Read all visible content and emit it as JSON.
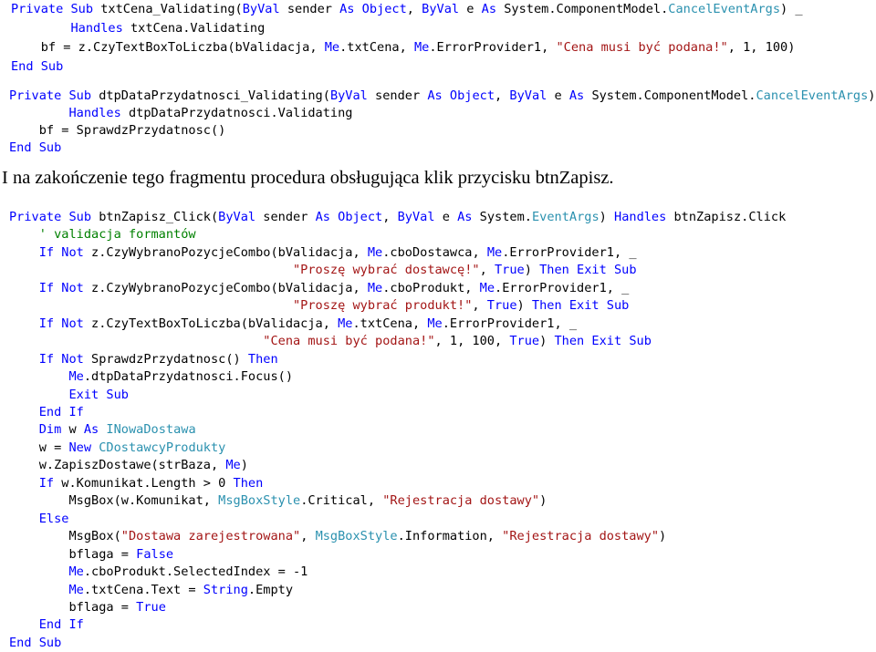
{
  "block1": [
    [
      [
        "kw",
        "Private Sub "
      ],
      [
        "tx",
        "txtCena_Validating("
      ],
      [
        "kw",
        "ByVal "
      ],
      [
        "tx",
        "sender "
      ],
      [
        "kw",
        "As Object"
      ],
      [
        "tx",
        ", "
      ],
      [
        "kw",
        "ByVal "
      ],
      [
        "tx",
        "e "
      ],
      [
        "kw",
        "As "
      ],
      [
        "tx",
        "System.ComponentModel."
      ],
      [
        "ty",
        "CancelEventArgs"
      ],
      [
        "tx",
        ") _"
      ]
    ],
    [
      [
        "kw",
        "        Handles "
      ],
      [
        "tx",
        "txtCena.Validating"
      ]
    ],
    [
      [
        "tx",
        "    bf = z.CzyTextBoxToLiczba(bValidacja, "
      ],
      [
        "kw",
        "Me"
      ],
      [
        "tx",
        ".txtCena, "
      ],
      [
        "kw",
        "Me"
      ],
      [
        "tx",
        ".ErrorProvider1, "
      ],
      [
        "st",
        "\"Cena musi być podana!\""
      ],
      [
        "tx",
        ", 1, 100)"
      ]
    ],
    [
      [
        "kw",
        "End Sub"
      ]
    ]
  ],
  "block2": [
    [
      [
        "kw",
        "Private Sub "
      ],
      [
        "tx",
        "dtpDataPrzydatnosci_Validating("
      ],
      [
        "kw",
        "ByVal "
      ],
      [
        "tx",
        "sender "
      ],
      [
        "kw",
        "As Object"
      ],
      [
        "tx",
        ", "
      ],
      [
        "kw",
        "ByVal "
      ],
      [
        "tx",
        "e "
      ],
      [
        "kw",
        "As "
      ],
      [
        "tx",
        "System.ComponentModel."
      ],
      [
        "ty",
        "CancelEventArgs"
      ],
      [
        "tx",
        ") _"
      ]
    ],
    [
      [
        "kw",
        "        Handles "
      ],
      [
        "tx",
        "dtpDataPrzydatnosci.Validating"
      ]
    ],
    [
      [
        "tx",
        "    bf = SprawdzPrzydatnosc()"
      ]
    ],
    [
      [
        "kw",
        "End Sub"
      ]
    ]
  ],
  "prose": "I na zakończenie tego fragmentu procedura obsługująca klik przycisku btnZapisz.",
  "block3": [
    [
      [
        "kw",
        "Private Sub "
      ],
      [
        "tx",
        "btnZapisz_Click("
      ],
      [
        "kw",
        "ByVal "
      ],
      [
        "tx",
        "sender "
      ],
      [
        "kw",
        "As Object"
      ],
      [
        "tx",
        ", "
      ],
      [
        "kw",
        "ByVal "
      ],
      [
        "tx",
        "e "
      ],
      [
        "kw",
        "As "
      ],
      [
        "tx",
        "System."
      ],
      [
        "ty",
        "EventArgs"
      ],
      [
        "tx",
        ") "
      ],
      [
        "kw",
        "Handles "
      ],
      [
        "tx",
        "btnZapisz.Click"
      ]
    ],
    [
      [
        "cm",
        "    ' validacja formantów"
      ]
    ],
    [
      [
        "kw",
        "    If Not "
      ],
      [
        "tx",
        "z.CzyWybranoPozycjeCombo(bValidacja, "
      ],
      [
        "kw",
        "Me"
      ],
      [
        "tx",
        ".cboDostawca, "
      ],
      [
        "kw",
        "Me"
      ],
      [
        "tx",
        ".ErrorProvider1, _"
      ]
    ],
    [
      [
        "tx",
        "                                      "
      ],
      [
        "st",
        "\"Proszę wybrać dostawcę!\""
      ],
      [
        "tx",
        ", "
      ],
      [
        "kw",
        "True"
      ],
      [
        "tx",
        ") "
      ],
      [
        "kw",
        "Then Exit Sub"
      ]
    ],
    [
      [
        "kw",
        "    If Not "
      ],
      [
        "tx",
        "z.CzyWybranoPozycjeCombo(bValidacja, "
      ],
      [
        "kw",
        "Me"
      ],
      [
        "tx",
        ".cboProdukt, "
      ],
      [
        "kw",
        "Me"
      ],
      [
        "tx",
        ".ErrorProvider1, _"
      ]
    ],
    [
      [
        "tx",
        "                                      "
      ],
      [
        "st",
        "\"Proszę wybrać produkt!\""
      ],
      [
        "tx",
        ", "
      ],
      [
        "kw",
        "True"
      ],
      [
        "tx",
        ") "
      ],
      [
        "kw",
        "Then Exit Sub"
      ]
    ],
    [
      [
        "kw",
        "    If Not "
      ],
      [
        "tx",
        "z.CzyTextBoxToLiczba(bValidacja, "
      ],
      [
        "kw",
        "Me"
      ],
      [
        "tx",
        ".txtCena, "
      ],
      [
        "kw",
        "Me"
      ],
      [
        "tx",
        ".ErrorProvider1, _"
      ]
    ],
    [
      [
        "tx",
        "                                  "
      ],
      [
        "st",
        "\"Cena musi być podana!\""
      ],
      [
        "tx",
        ", 1, 100, "
      ],
      [
        "kw",
        "True"
      ],
      [
        "tx",
        ") "
      ],
      [
        "kw",
        "Then Exit Sub"
      ]
    ],
    [
      [
        "kw",
        "    If Not "
      ],
      [
        "tx",
        "SprawdzPrzydatnosc() "
      ],
      [
        "kw",
        "Then"
      ]
    ],
    [
      [
        "kw",
        "        Me"
      ],
      [
        "tx",
        ".dtpDataPrzydatnosci.Focus()"
      ]
    ],
    [
      [
        "kw",
        "        Exit Sub"
      ]
    ],
    [
      [
        "kw",
        "    End If"
      ]
    ],
    [
      [
        "kw",
        "    Dim "
      ],
      [
        "tx",
        "w "
      ],
      [
        "kw",
        "As "
      ],
      [
        "ty",
        "INowaDostawa"
      ]
    ],
    [
      [
        "tx",
        "    w = "
      ],
      [
        "kw",
        "New "
      ],
      [
        "ty",
        "CDostawcyProdukty"
      ]
    ],
    [
      [
        "tx",
        "    w.ZapiszDostawe(strBaza, "
      ],
      [
        "kw",
        "Me"
      ],
      [
        "tx",
        ")"
      ]
    ],
    [
      [
        "kw",
        "    If "
      ],
      [
        "tx",
        "w.Komunikat.Length > 0 "
      ],
      [
        "kw",
        "Then"
      ]
    ],
    [
      [
        "tx",
        "        MsgBox(w.Komunikat, "
      ],
      [
        "ty",
        "MsgBoxStyle"
      ],
      [
        "tx",
        ".Critical, "
      ],
      [
        "st",
        "\"Rejestracja dostawy\""
      ],
      [
        "tx",
        ")"
      ]
    ],
    [
      [
        "kw",
        "    Else"
      ]
    ],
    [
      [
        "tx",
        "        MsgBox("
      ],
      [
        "st",
        "\"Dostawa zarejestrowana\""
      ],
      [
        "tx",
        ", "
      ],
      [
        "ty",
        "MsgBoxStyle"
      ],
      [
        "tx",
        ".Information, "
      ],
      [
        "st",
        "\"Rejestracja dostawy\""
      ],
      [
        "tx",
        ")"
      ]
    ],
    [
      [
        "tx",
        "        bflaga = "
      ],
      [
        "kw",
        "False"
      ]
    ],
    [
      [
        "kw",
        "        Me"
      ],
      [
        "tx",
        ".cboProdukt.SelectedIndex = -1"
      ]
    ],
    [
      [
        "kw",
        "        Me"
      ],
      [
        "tx",
        ".txtCena.Text = "
      ],
      [
        "kw",
        "String"
      ],
      [
        "tx",
        ".Empty"
      ]
    ],
    [
      [
        "tx",
        "        bflaga = "
      ],
      [
        "kw",
        "True"
      ]
    ],
    [
      [
        "kw",
        "    End If"
      ]
    ],
    [
      [
        "kw",
        "End Sub"
      ]
    ]
  ]
}
